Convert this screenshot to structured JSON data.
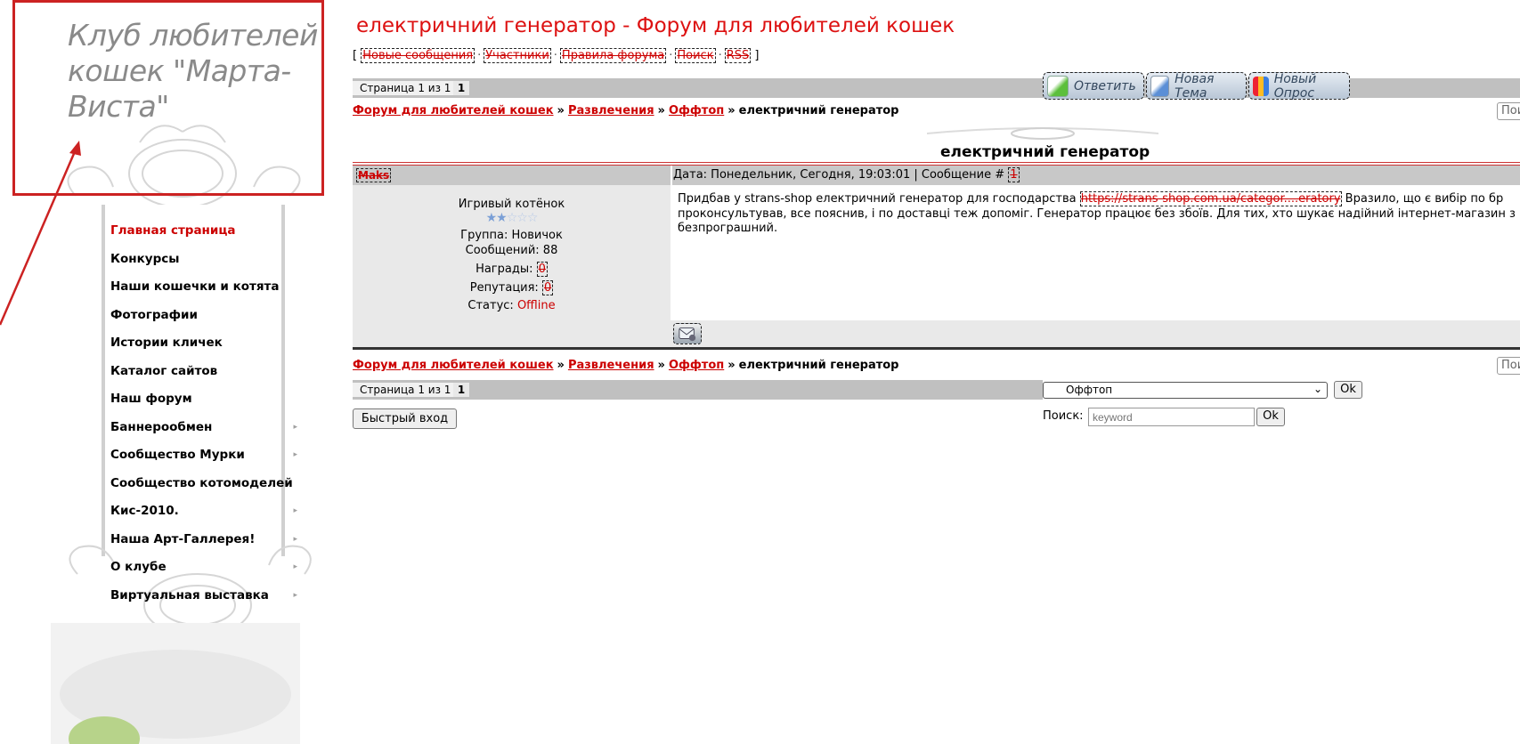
{
  "colors": {
    "accent": "#cc0000",
    "bar": "#c0c0c0",
    "annotation": "#cc2222"
  },
  "sidebar": {
    "club_title": "Клуб любителей кошек \"Марта-Виста\"",
    "menu": [
      {
        "label": "Главная страница",
        "has_submenu": false,
        "active": true
      },
      {
        "label": "Конкурсы",
        "has_submenu": false
      },
      {
        "label": "Наши кошечки и котята",
        "has_submenu": false
      },
      {
        "label": "Фотографии",
        "has_submenu": false
      },
      {
        "label": "Истории кличек",
        "has_submenu": false
      },
      {
        "label": "Каталог сайтов",
        "has_submenu": false
      },
      {
        "label": "Наш форум",
        "has_submenu": false
      },
      {
        "label": "Баннерообмен",
        "has_submenu": true
      },
      {
        "label": "Сообщество Мурки",
        "has_submenu": true
      },
      {
        "label": "Сообщество котомоделей",
        "has_submenu": false
      },
      {
        "label": "Кис-2010.",
        "has_submenu": true
      },
      {
        "label": "Наша Арт-Галлерея!",
        "has_submenu": true
      },
      {
        "label": "О клубе",
        "has_submenu": true
      },
      {
        "label": "Виртуальная выставка",
        "has_submenu": true
      }
    ],
    "submenu_arrow": "▸"
  },
  "header": {
    "title": "електричний генератор - Форум для любителей кошек",
    "nav_open": "[",
    "nav_close": "]",
    "nav_sep": "·",
    "nav": [
      "Новые сообщения",
      "Участники",
      "Правила форума",
      "Поиск",
      "RSS"
    ]
  },
  "pager": {
    "label": "Страница 1 из 1",
    "current": "1"
  },
  "actions": {
    "reply": "Ответить",
    "new_topic": "Новая Тема",
    "new_poll": "Новый Опрос"
  },
  "breadcrumb": {
    "items": [
      "Форум для любителей кошек",
      "Развлечения",
      "Оффтоп"
    ],
    "current": "електричний генератор",
    "sep": "»"
  },
  "search_stub_placeholder": "Пои",
  "topic": {
    "title": "електричний генератор"
  },
  "post": {
    "author": "Maks",
    "date_text": "Дата: Понедельник, Сегодня, 19:03:01 | Сообщение #",
    "number": "1",
    "user_rank": "Игривый котёнок",
    "stars_filled": 2,
    "stars_total": 5,
    "star_char": "★",
    "star_empty_char": "☆",
    "group": "Группа: Новичок",
    "messages": "Сообщений: 88",
    "awards_label": "Награды:",
    "awards": "0",
    "reputation_label": "Репутация:",
    "reputation": "0",
    "status_label": "Статус:",
    "status": "Offline",
    "body_line1_pre": "Придбав у strans-shop електричний генератор для господарства ",
    "body_link": "https://strans-shop.com.ua/categor....eratory",
    "body_line1_post": " Вразило, що є вибір по бр",
    "body_line2": "проконсультував, все пояснив, і по доставці теж допоміг. Генератор працює без збоїв. Для тих, хто шукає надійний інтернет-магазин з",
    "body_line3": "безпрограшний."
  },
  "footer": {
    "forum_select": "Оффтоп",
    "ok": "Ok",
    "quick_login": "Быстрый вход",
    "search_label": "Поиск:",
    "search_placeholder": "keyword"
  }
}
